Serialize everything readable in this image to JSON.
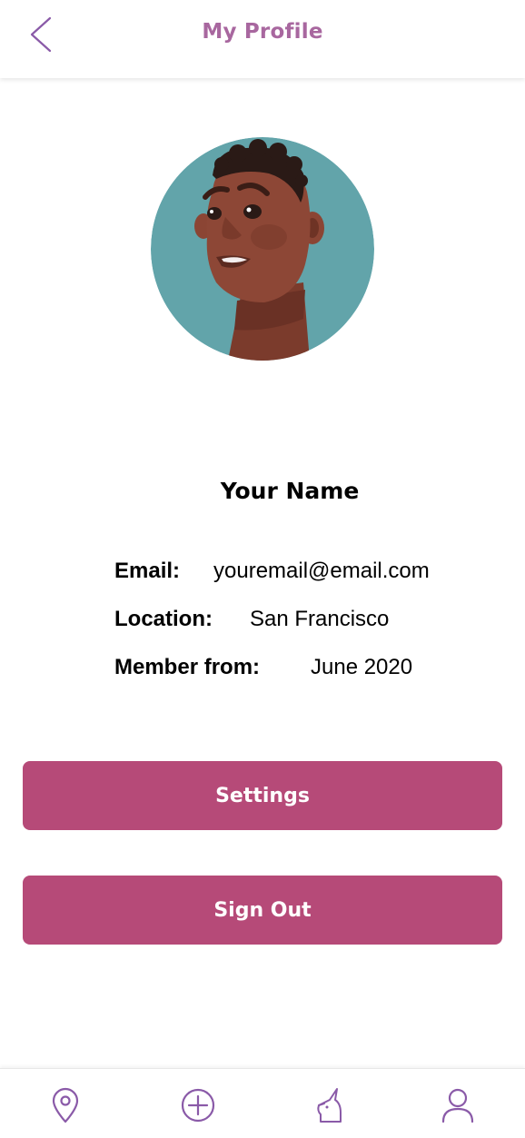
{
  "header": {
    "title": "My Profile",
    "back_icon": "chevron-left-icon"
  },
  "profile": {
    "avatar_icon": "user-avatar-illustration",
    "avatar_background": "#62a4aa",
    "name": "Your Name",
    "fields": [
      {
        "label": "Email:",
        "value": "youremail@email.com"
      },
      {
        "label": "Location:",
        "value": "San Francisco"
      },
      {
        "label": "Member from:",
        "value": "June 2020"
      }
    ]
  },
  "actions": {
    "settings_label": "Settings",
    "signout_label": "Sign Out"
  },
  "bottom_nav": {
    "items": [
      {
        "icon": "location-pin-icon"
      },
      {
        "icon": "add-circle-icon"
      },
      {
        "icon": "unicorn-icon"
      },
      {
        "icon": "user-profile-icon"
      }
    ]
  },
  "colors": {
    "accent": "#a8679f",
    "button": "#b64a78",
    "nav_icon": "#8a5aa8"
  }
}
